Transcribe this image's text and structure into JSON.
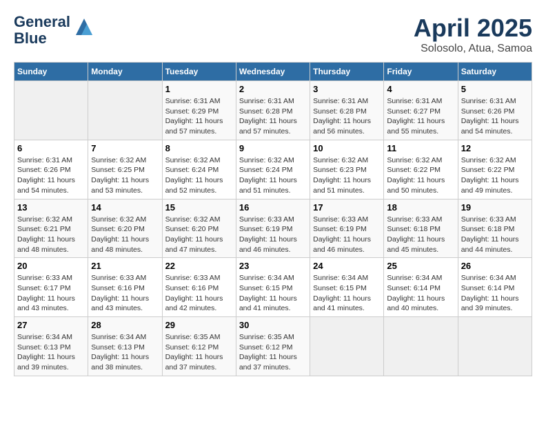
{
  "header": {
    "logo_line1": "General",
    "logo_line2": "Blue",
    "title": "April 2025",
    "subtitle": "Solosolo, Atua, Samoa"
  },
  "weekdays": [
    "Sunday",
    "Monday",
    "Tuesday",
    "Wednesday",
    "Thursday",
    "Friday",
    "Saturday"
  ],
  "weeks": [
    [
      {
        "day": "",
        "info": ""
      },
      {
        "day": "",
        "info": ""
      },
      {
        "day": "1",
        "info": "Sunrise: 6:31 AM\nSunset: 6:29 PM\nDaylight: 11 hours and 57 minutes."
      },
      {
        "day": "2",
        "info": "Sunrise: 6:31 AM\nSunset: 6:28 PM\nDaylight: 11 hours and 57 minutes."
      },
      {
        "day": "3",
        "info": "Sunrise: 6:31 AM\nSunset: 6:28 PM\nDaylight: 11 hours and 56 minutes."
      },
      {
        "day": "4",
        "info": "Sunrise: 6:31 AM\nSunset: 6:27 PM\nDaylight: 11 hours and 55 minutes."
      },
      {
        "day": "5",
        "info": "Sunrise: 6:31 AM\nSunset: 6:26 PM\nDaylight: 11 hours and 54 minutes."
      }
    ],
    [
      {
        "day": "6",
        "info": "Sunrise: 6:31 AM\nSunset: 6:26 PM\nDaylight: 11 hours and 54 minutes."
      },
      {
        "day": "7",
        "info": "Sunrise: 6:32 AM\nSunset: 6:25 PM\nDaylight: 11 hours and 53 minutes."
      },
      {
        "day": "8",
        "info": "Sunrise: 6:32 AM\nSunset: 6:24 PM\nDaylight: 11 hours and 52 minutes."
      },
      {
        "day": "9",
        "info": "Sunrise: 6:32 AM\nSunset: 6:24 PM\nDaylight: 11 hours and 51 minutes."
      },
      {
        "day": "10",
        "info": "Sunrise: 6:32 AM\nSunset: 6:23 PM\nDaylight: 11 hours and 51 minutes."
      },
      {
        "day": "11",
        "info": "Sunrise: 6:32 AM\nSunset: 6:22 PM\nDaylight: 11 hours and 50 minutes."
      },
      {
        "day": "12",
        "info": "Sunrise: 6:32 AM\nSunset: 6:22 PM\nDaylight: 11 hours and 49 minutes."
      }
    ],
    [
      {
        "day": "13",
        "info": "Sunrise: 6:32 AM\nSunset: 6:21 PM\nDaylight: 11 hours and 48 minutes."
      },
      {
        "day": "14",
        "info": "Sunrise: 6:32 AM\nSunset: 6:20 PM\nDaylight: 11 hours and 48 minutes."
      },
      {
        "day": "15",
        "info": "Sunrise: 6:32 AM\nSunset: 6:20 PM\nDaylight: 11 hours and 47 minutes."
      },
      {
        "day": "16",
        "info": "Sunrise: 6:33 AM\nSunset: 6:19 PM\nDaylight: 11 hours and 46 minutes."
      },
      {
        "day": "17",
        "info": "Sunrise: 6:33 AM\nSunset: 6:19 PM\nDaylight: 11 hours and 46 minutes."
      },
      {
        "day": "18",
        "info": "Sunrise: 6:33 AM\nSunset: 6:18 PM\nDaylight: 11 hours and 45 minutes."
      },
      {
        "day": "19",
        "info": "Sunrise: 6:33 AM\nSunset: 6:18 PM\nDaylight: 11 hours and 44 minutes."
      }
    ],
    [
      {
        "day": "20",
        "info": "Sunrise: 6:33 AM\nSunset: 6:17 PM\nDaylight: 11 hours and 43 minutes."
      },
      {
        "day": "21",
        "info": "Sunrise: 6:33 AM\nSunset: 6:16 PM\nDaylight: 11 hours and 43 minutes."
      },
      {
        "day": "22",
        "info": "Sunrise: 6:33 AM\nSunset: 6:16 PM\nDaylight: 11 hours and 42 minutes."
      },
      {
        "day": "23",
        "info": "Sunrise: 6:34 AM\nSunset: 6:15 PM\nDaylight: 11 hours and 41 minutes."
      },
      {
        "day": "24",
        "info": "Sunrise: 6:34 AM\nSunset: 6:15 PM\nDaylight: 11 hours and 41 minutes."
      },
      {
        "day": "25",
        "info": "Sunrise: 6:34 AM\nSunset: 6:14 PM\nDaylight: 11 hours and 40 minutes."
      },
      {
        "day": "26",
        "info": "Sunrise: 6:34 AM\nSunset: 6:14 PM\nDaylight: 11 hours and 39 minutes."
      }
    ],
    [
      {
        "day": "27",
        "info": "Sunrise: 6:34 AM\nSunset: 6:13 PM\nDaylight: 11 hours and 39 minutes."
      },
      {
        "day": "28",
        "info": "Sunrise: 6:34 AM\nSunset: 6:13 PM\nDaylight: 11 hours and 38 minutes."
      },
      {
        "day": "29",
        "info": "Sunrise: 6:35 AM\nSunset: 6:12 PM\nDaylight: 11 hours and 37 minutes."
      },
      {
        "day": "30",
        "info": "Sunrise: 6:35 AM\nSunset: 6:12 PM\nDaylight: 11 hours and 37 minutes."
      },
      {
        "day": "",
        "info": ""
      },
      {
        "day": "",
        "info": ""
      },
      {
        "day": "",
        "info": ""
      }
    ]
  ]
}
